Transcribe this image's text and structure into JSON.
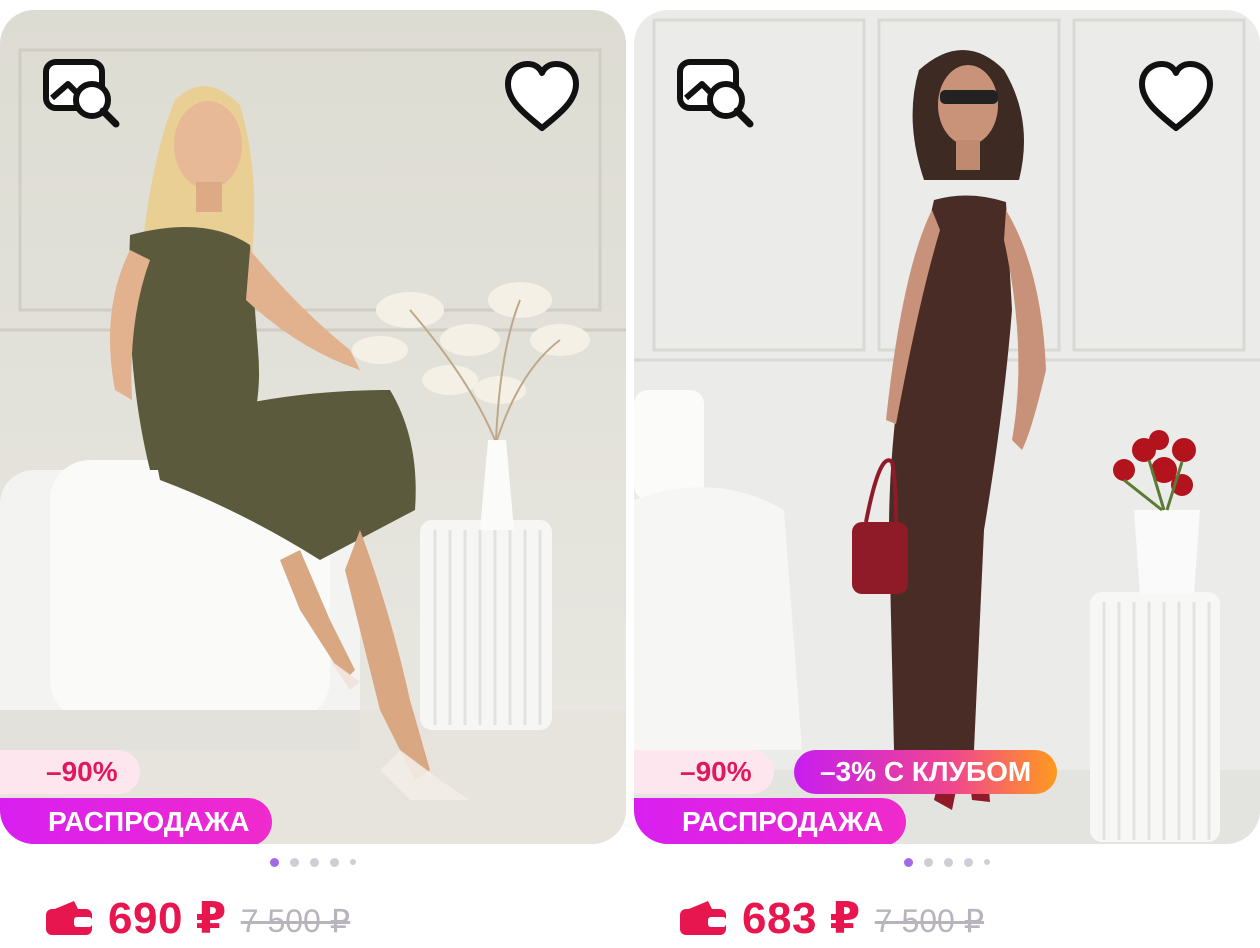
{
  "products": [
    {
      "discount_badge": "–90%",
      "sale_badge": "РАСПРОДАЖА",
      "price": "690 ₽",
      "old_price": "7 500 ₽",
      "image_dots": {
        "count": 5,
        "active_index": 0
      }
    },
    {
      "discount_badge": "–90%",
      "club_badge": "–3% С КЛУБОМ",
      "sale_badge": "РАСПРОДАЖА",
      "price": "683 ₽",
      "old_price": "7 500 ₽",
      "image_dots": {
        "count": 5,
        "active_index": 0
      }
    }
  ],
  "icons": {
    "image_search": "image-search-icon",
    "favorite": "heart-outline-icon",
    "wallet": "wallet-icon"
  },
  "colors": {
    "price": "#e8164f",
    "discount_text": "#e0195f",
    "discount_bg": "#fde6ee",
    "sale_gradient": [
      "#d81ff0",
      "#f02acb"
    ],
    "club_gradient": [
      "#c71df0",
      "#f0468f",
      "#ff9a1e"
    ],
    "old_price": "#b8b3bd",
    "dot_active": "#a36ae8",
    "dot_inactive": "#d0cdd6"
  }
}
